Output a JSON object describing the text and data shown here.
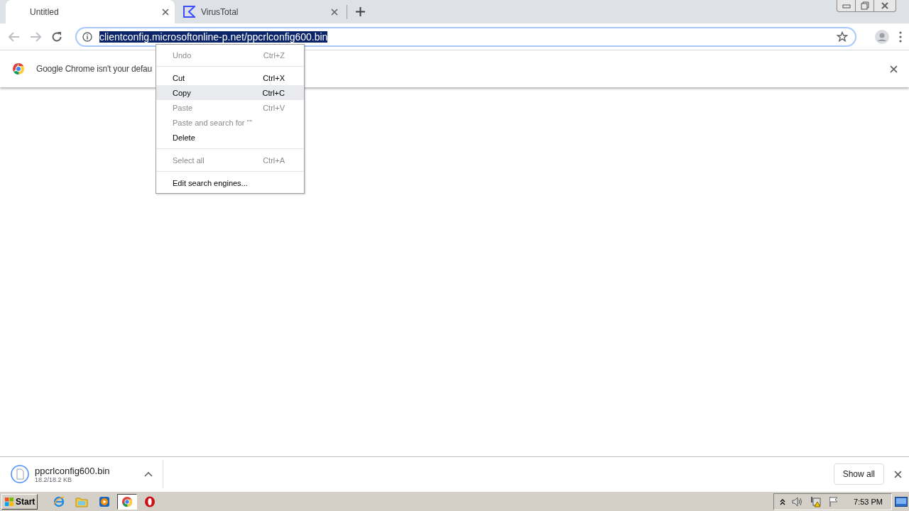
{
  "tabs": [
    {
      "title": "Untitled",
      "selected": true,
      "kind": "blank"
    },
    {
      "title": "VirusTotal",
      "selected": false,
      "kind": "site"
    }
  ],
  "address_bar": {
    "url": "clientconfig.microsoftonline-p.net/ppcrlconfig600.bin",
    "selected": true
  },
  "infobar": {
    "message": "Google Chrome isn't your defau"
  },
  "context_menu": {
    "items": [
      {
        "kind": "item",
        "label": "Undo",
        "shortcut": "Ctrl+Z",
        "disabled": true,
        "selected": false
      },
      {
        "kind": "separator"
      },
      {
        "kind": "item",
        "label": "Cut",
        "shortcut": "Ctrl+X",
        "disabled": false,
        "selected": false
      },
      {
        "kind": "item",
        "label": "Copy",
        "shortcut": "Ctrl+C",
        "disabled": false,
        "selected": true
      },
      {
        "kind": "item",
        "label": "Paste",
        "shortcut": "Ctrl+V",
        "disabled": true,
        "selected": false
      },
      {
        "kind": "item",
        "label": "Paste and search for “”",
        "disabled": true,
        "selected": false
      },
      {
        "kind": "item",
        "label": "Delete",
        "disabled": false,
        "selected": false
      },
      {
        "kind": "separator"
      },
      {
        "kind": "item",
        "label": "Select all",
        "shortcut": "Ctrl+A",
        "disabled": true,
        "selected": false
      },
      {
        "kind": "separator"
      },
      {
        "kind": "item",
        "label": "Edit search engines...",
        "disabled": false,
        "selected": false
      }
    ]
  },
  "download_shelf": {
    "downloads": [
      {
        "filename": "ppcrlconfig600.bin",
        "size": "18.2/18.2 KB"
      }
    ],
    "show_all": "Show all"
  },
  "taskbar": {
    "start": "Start",
    "apps": [
      {
        "kind": "ie",
        "selected": false
      },
      {
        "kind": "explorer",
        "selected": false
      },
      {
        "kind": "media",
        "selected": false
      },
      {
        "kind": "chrome",
        "selected": true
      },
      {
        "kind": "opera",
        "selected": false
      }
    ],
    "clock": "7:53 PM"
  }
}
